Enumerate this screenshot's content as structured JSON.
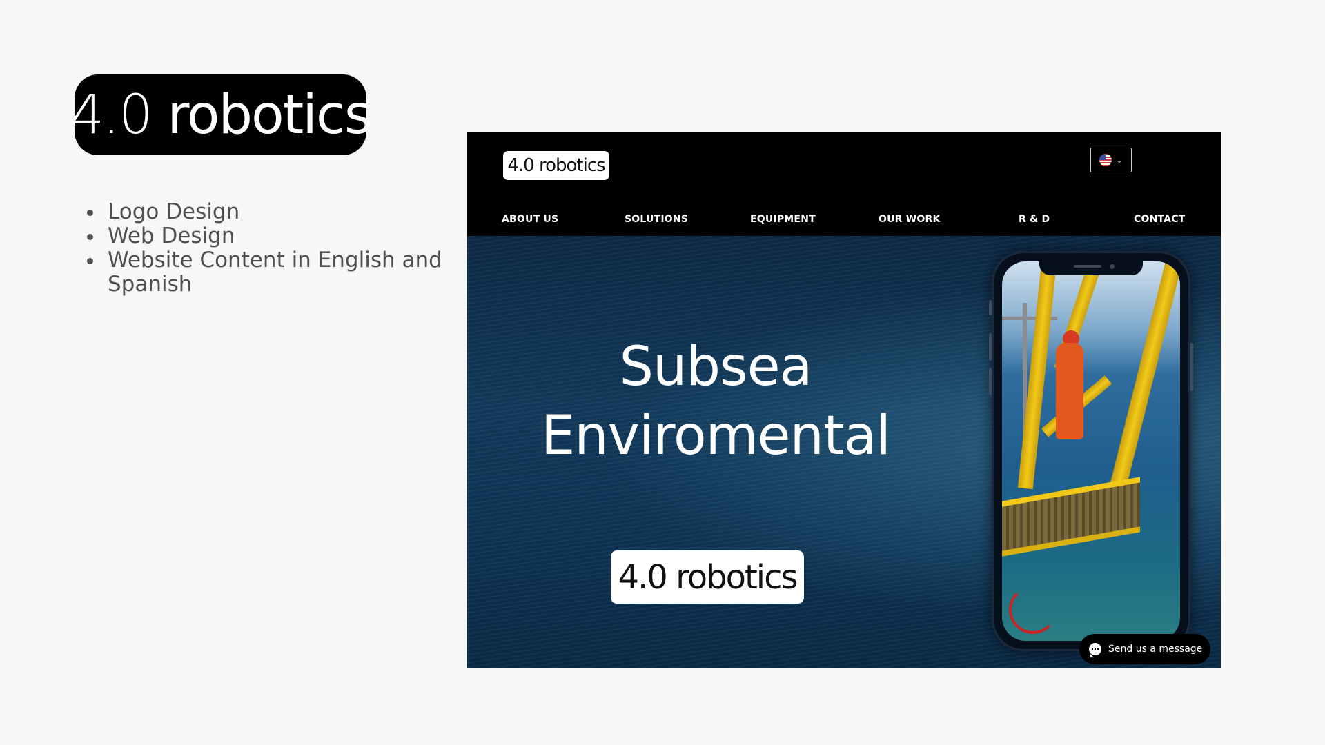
{
  "brand": {
    "logo_number": "4.0",
    "logo_word": " robotics"
  },
  "services": [
    "Logo Design",
    "Web Design",
    "Website Content in English and Spanish"
  ],
  "site": {
    "header_logo_number": "4.0",
    "header_logo_word": " robotics",
    "language_icon": "us-flag-icon",
    "nav": [
      "ABOUT US",
      "SOLUTIONS",
      "EQUIPMENT",
      "OUR WORK",
      "R & D",
      "CONTACT"
    ],
    "hero_title_line1": "Subsea",
    "hero_title_line2": "Enviromental",
    "hero_logo_number": "4.0",
    "hero_logo_word": " robotics",
    "chat_label": "Send us a message"
  },
  "colors": {
    "page_background": "#f7f7f5",
    "accent_black": "#000000",
    "ocean_blue": "#123a5c",
    "equipment_yellow": "#f2c918",
    "worker_orange": "#e2581d"
  }
}
